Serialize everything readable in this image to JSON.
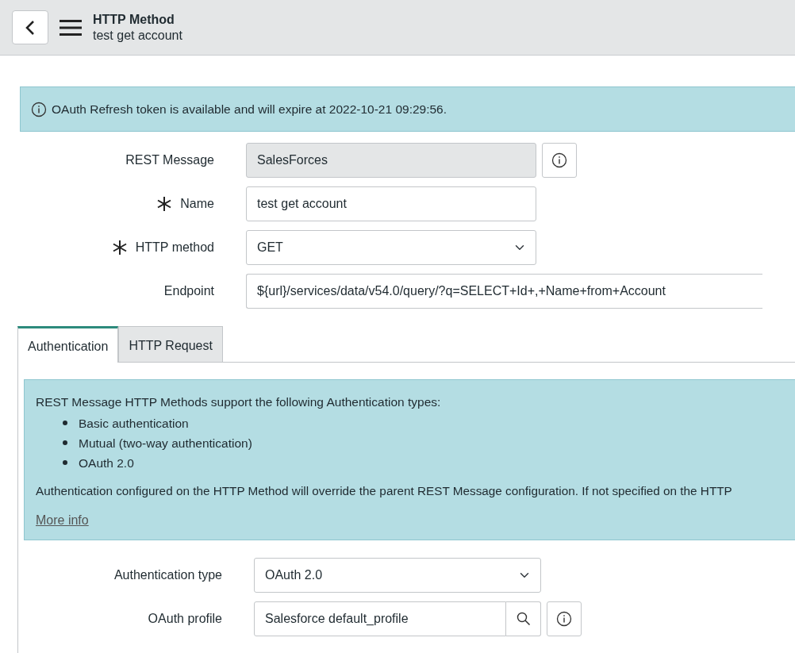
{
  "header": {
    "title": "HTTP Method",
    "subtitle": "test get account"
  },
  "alert": {
    "text": "OAuth Refresh token is available and will expire at 2022-10-21 09:29:56."
  },
  "fields": [
    {
      "label": "REST Message",
      "kind": "reference",
      "value": "SalesForces",
      "readonly": true,
      "required": false
    },
    {
      "label": "Name",
      "kind": "text",
      "value": "test get account",
      "readonly": false,
      "required": true
    },
    {
      "label": "HTTP method",
      "kind": "select",
      "value": "GET",
      "readonly": false,
      "required": true
    },
    {
      "label": "Endpoint",
      "kind": "wide",
      "value": "${url}/services/data/v54.0/query/?q=SELECT+Id+,+Name+from+Account",
      "readonly": false,
      "required": false
    }
  ],
  "tabs": [
    {
      "label": "Authentication",
      "selected": true
    },
    {
      "label": "HTTP Request",
      "selected": false
    }
  ],
  "auth_info": {
    "intro": "REST Message HTTP Methods support the following Authentication types:",
    "types": [
      "Basic authentication",
      "Mutual (two-way authentication)",
      "OAuth 2.0"
    ],
    "note": "Authentication configured on the HTTP Method will override the parent REST Message configuration. If not specified on the HTTP",
    "link": "More info"
  },
  "auth_fields": [
    {
      "label": "Authentication type",
      "kind": "select",
      "value": "OAuth 2.0",
      "readonly": false,
      "required": false
    },
    {
      "label": "OAuth profile",
      "kind": "lookup",
      "value": "Salesforce default_profile",
      "readonly": false,
      "required": false
    }
  ]
}
